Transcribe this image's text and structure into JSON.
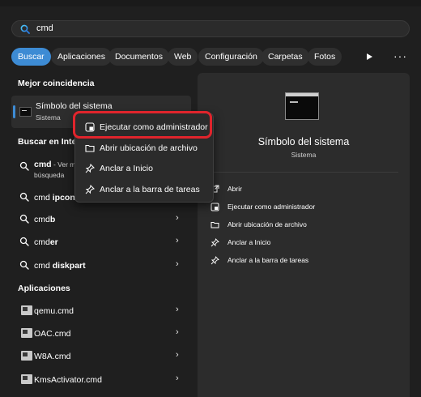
{
  "search": {
    "query": "cmd"
  },
  "filters": {
    "chips": [
      "Buscar",
      "Aplicaciones",
      "Documentos",
      "Web",
      "Configuración",
      "Carpetas",
      "Fotos"
    ],
    "more": "···"
  },
  "best_match": {
    "heading": "Mejor coincidencia",
    "title": "Símbolo del sistema",
    "subtitle": "Sistema"
  },
  "web_search": {
    "heading": "Buscar en Intern",
    "first_prefix": "cmd",
    "first_suffix": " - Ver m",
    "first_line2": "búsqueda",
    "items": [
      {
        "pre": "cmd ",
        "bold": "ipconfi"
      },
      {
        "pre": "cmd",
        "bold": "b"
      },
      {
        "pre": "cmd",
        "bold": "er"
      },
      {
        "pre": "cmd ",
        "bold": "diskpart"
      }
    ]
  },
  "apps": {
    "heading": "Aplicaciones",
    "items": [
      "qemu.cmd",
      "OAC.cmd",
      "W8A.cmd",
      "KmsActivator.cmd"
    ]
  },
  "details": {
    "title": "Símbolo del sistema",
    "subtitle": "Sistema",
    "actions": [
      {
        "label": "Abrir",
        "icon": "open-external-icon"
      },
      {
        "label": "Ejecutar como administrador",
        "icon": "shield-admin-icon"
      },
      {
        "label": "Abrir ubicación de archivo",
        "icon": "folder-icon"
      },
      {
        "label": "Anclar a Inicio",
        "icon": "pin-icon"
      },
      {
        "label": "Anclar a la barra de tareas",
        "icon": "pin-taskbar-icon"
      }
    ]
  },
  "context_menu": {
    "items": [
      {
        "label": "Ejecutar como administrador",
        "icon": "shield-admin-icon"
      },
      {
        "label": "Abrir ubicación de archivo",
        "icon": "folder-icon"
      },
      {
        "label": "Anclar a Inicio",
        "icon": "pin-icon"
      },
      {
        "label": "Anclar a la barra de tareas",
        "icon": "pin-taskbar-icon"
      }
    ]
  },
  "colors": {
    "accent": "#3d8bd4",
    "highlight_ring": "#e0242c",
    "background": "#1f1f1f",
    "panel": "#2c2c2c"
  }
}
